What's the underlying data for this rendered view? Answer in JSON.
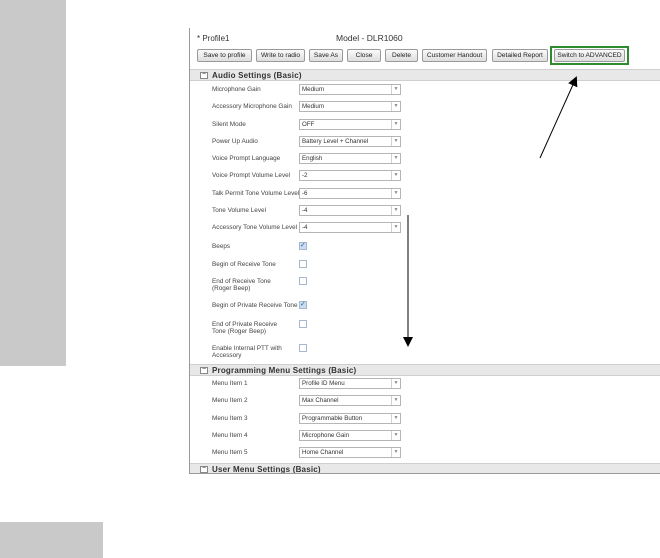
{
  "window": {
    "profile_name": "* Profile1",
    "model_title": "Model - DLR1060"
  },
  "toolbar": {
    "buttons": [
      "Save to profile",
      "Write to radio",
      "Save As",
      "Close",
      "Delete",
      "Customer Handout",
      "Detailed Report",
      "Switch to ADVANCED"
    ]
  },
  "audio": {
    "title": "Audio Settings (Basic)",
    "toggle": "−",
    "rows": [
      {
        "label": "Microphone Gain",
        "value": "Medium"
      },
      {
        "label": "Accessory Microphone Gain",
        "value": "Medium"
      },
      {
        "label": "Silent Mode",
        "value": "OFF"
      },
      {
        "label": "Power Up Audio",
        "value": "Battery Level + Channel"
      },
      {
        "label": "Voice Prompt Language",
        "value": "English"
      },
      {
        "label": "Voice Prompt Volume Level",
        "value": "-2"
      },
      {
        "label": "Talk Permit Tone Volume Level",
        "value": "-6"
      },
      {
        "label": "Tone Volume Level",
        "value": "-4"
      },
      {
        "label": "Accessory Tone Volume Level",
        "value": "-4"
      }
    ],
    "checks": [
      {
        "label": "Beeps",
        "checked": true
      },
      {
        "label": "Begin of Receive Tone",
        "checked": false
      },
      {
        "label": "End of Receive Tone (Roger Beep)",
        "checked": false
      },
      {
        "label": "Begin of Private Receive Tone",
        "checked": true
      },
      {
        "label": "End of Private Receive Tone (Roger Beep)",
        "checked": false
      },
      {
        "label": "Enable Internal PTT with Accessory",
        "checked": false
      }
    ]
  },
  "programming": {
    "title": "Programming Menu Settings (Basic)",
    "toggle": "−",
    "rows": [
      {
        "label": "Menu Item 1",
        "value": "Profile ID Menu"
      },
      {
        "label": "Menu Item 2",
        "value": "Max Channel"
      },
      {
        "label": "Menu Item 3",
        "value": "Programmable Button"
      },
      {
        "label": "Menu Item 4",
        "value": "Microphone Gain"
      },
      {
        "label": "Menu Item 5",
        "value": "Home Channel"
      }
    ]
  },
  "user_menu": {
    "title": "User Menu Settings (Basic)",
    "toggle": "−"
  },
  "icons": {
    "dropdown": "chevron-down-icon",
    "checkbox_mark": "check-icon",
    "collapse": "minus-icon"
  },
  "colors": {
    "highlight_frame": "#2e8b2e",
    "checkbox_checked": "#c9dcf2",
    "side_panel": "#c9c9c9"
  }
}
